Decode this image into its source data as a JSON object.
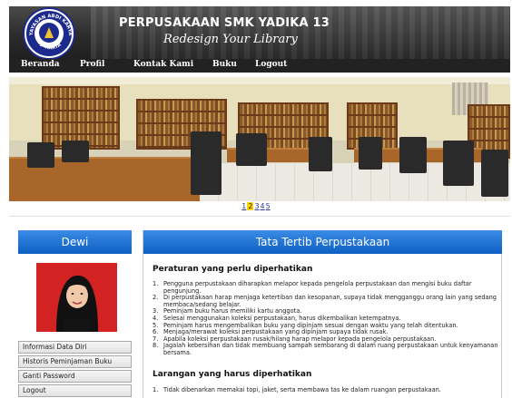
{
  "header": {
    "title": "PERPUSAKAAN SMK YADIKA 13",
    "tagline": "Redesign Your Library",
    "logo": {
      "name": "school-logo",
      "text_top": "YAYASAN ABDI KARYA",
      "text_bottom": "JAKARTA"
    }
  },
  "nav": [
    {
      "label": "Beranda"
    },
    {
      "label": "Profil"
    },
    {
      "label": "Kontak Kami"
    },
    {
      "label": "Buku"
    },
    {
      "label": "Logout"
    }
  ],
  "slideshow": {
    "pages": [
      "1",
      "2",
      "3",
      "4",
      "5"
    ],
    "active": "2"
  },
  "sidebar": {
    "username": "Dewi",
    "menu": [
      {
        "label": "Informasi Data Diri"
      },
      {
        "label": "Historis Peminjaman Buku"
      },
      {
        "label": "Ganti Password"
      },
      {
        "label": "Logout"
      }
    ]
  },
  "content": {
    "heading": "Tata Tertib Perpustakaan",
    "section1_title": "Peraturan yang perlu diperhatikan",
    "rules": [
      {
        "num": "1.",
        "text": "Pengguna perpustakaan diharapkan melapor kepada pengelola perpustakaan dan mengisi buku daftar pengunjung."
      },
      {
        "num": "2.",
        "text": "Di perpustakaan harap menjaga ketertiban dan kesopanan, supaya tidak mengganggu orang lain yang sedang membaca/sedang belajar."
      },
      {
        "num": "3.",
        "text": "Peminjam buku harus memiliki kartu anggota."
      },
      {
        "num": "4.",
        "text": "Selesai menggunakan koleksi perpustakaan, harus dikembalikan ketempatnya."
      },
      {
        "num": "5.",
        "text": "Peminjam harus mengembalikan buku yang dipinjam sesuai dengan waktu yang telah ditentukan."
      },
      {
        "num": "6.",
        "text": "Menjaga/merawat koleksi perpustakaan yang dipinjam supaya tidak rusak."
      },
      {
        "num": "7.",
        "text": "Apabila koleksi perpustakaan rusak/hilang harap melapor kepada pengelola perpustakaan."
      },
      {
        "num": "8.",
        "text": "Jagalah kebersihan dan tidak membuang sampah sembarang di dalam ruang perpustakaan untuk kenyamanan bersama."
      }
    ],
    "section2_title": "Larangan yang harus diperhatikan",
    "prohibitions": [
      {
        "num": "1.",
        "text": "Tidak dibenarkan memakai topi, jaket, serta membawa tas ke dalam ruangan perpustakaan."
      }
    ]
  },
  "colors": {
    "panel_header": "#0d5fc2",
    "navbar": "#222222",
    "photo_background": "#d32222"
  }
}
